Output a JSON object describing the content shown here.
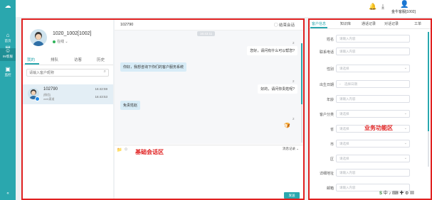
{
  "sidebar": {
    "logo": "☁",
    "items": [
      {
        "label": "首页",
        "icon": "home-icon"
      },
      {
        "label": "工作台",
        "icon": "desk-icon"
      },
      {
        "label": "IM客服",
        "icon": "chat-agent-icon"
      },
      {
        "label": "监控",
        "icon": "monitor-icon"
      }
    ],
    "bottom_icon": "double-chevron-icon",
    "bottom_glyph": "«"
  },
  "topbar": {
    "user_name": "金牛客服[1002]",
    "bell_glyph": "🔔",
    "download_glyph": "⤓",
    "user_glyph": "👤"
  },
  "contacts": {
    "agent_name": "1020_1002[1002]",
    "agent_status": "在线",
    "tabs": [
      "我的",
      "排队",
      "访客",
      "历史"
    ],
    "search_placeholder": "请输入客户昵称",
    "session": {
      "id": "102790",
      "sub1": "[微信]",
      "sub2": "web渠道",
      "time1": "16:42:59",
      "time2": "16:43:53"
    }
  },
  "chat": {
    "title": "102790",
    "end_label": "◯ 结束会话",
    "time_pill": "16:43:11",
    "messages": [
      {
        "side": "right",
        "num": "2",
        "text": "您好，请问有什么可以帮您?"
      },
      {
        "side": "left",
        "text": "你好，我想咨询下你们的客户服务系统"
      },
      {
        "side": "right",
        "num": "2",
        "text": "好的，请问你贵姓呢?"
      },
      {
        "side": "left",
        "text": "免贵姓赵"
      },
      {
        "side": "right",
        "num": "2",
        "text": "🍞"
      }
    ],
    "input_icons": [
      "📁",
      "☺"
    ],
    "record_label": "消息记录 ⌄",
    "send_label": "发送"
  },
  "business": {
    "tabs": [
      "客户信息",
      "知识库",
      "通话记录",
      "对话记录",
      "工单"
    ],
    "fields": [
      {
        "label": "姓名",
        "placeholder": "请输入内容",
        "type": "input"
      },
      {
        "label": "联系电话",
        "placeholder": "请输入内容",
        "type": "input"
      },
      {
        "label": "性别",
        "placeholder": "请选择",
        "type": "select"
      },
      {
        "label": "出生日期",
        "placeholder": "选择日期",
        "type": "date"
      },
      {
        "label": "年龄",
        "placeholder": "请输入内容",
        "type": "input"
      },
      {
        "label": "客户分类",
        "placeholder": "请选择",
        "type": "select"
      },
      {
        "label": "省",
        "placeholder": "请选择",
        "type": "select"
      },
      {
        "label": "市",
        "placeholder": "请选择",
        "type": "select"
      },
      {
        "label": "区",
        "placeholder": "请选择",
        "type": "select"
      },
      {
        "label": "详细地址",
        "placeholder": "请输入内容",
        "type": "input"
      },
      {
        "label": "邮箱",
        "placeholder": "请输入内容",
        "type": "input"
      }
    ]
  },
  "annotations": {
    "left_label": "基础会话区",
    "right_label": "业务功能区",
    "color": "#e02020"
  },
  "ime": {
    "s": "S",
    "rest": "中 ♪ ⌨ ✚ ⚙ ▦"
  },
  "colors": {
    "accent": "#2aa7ae",
    "sidebar": "#2aa7ae",
    "bubble_left": "#d7ecf7"
  }
}
